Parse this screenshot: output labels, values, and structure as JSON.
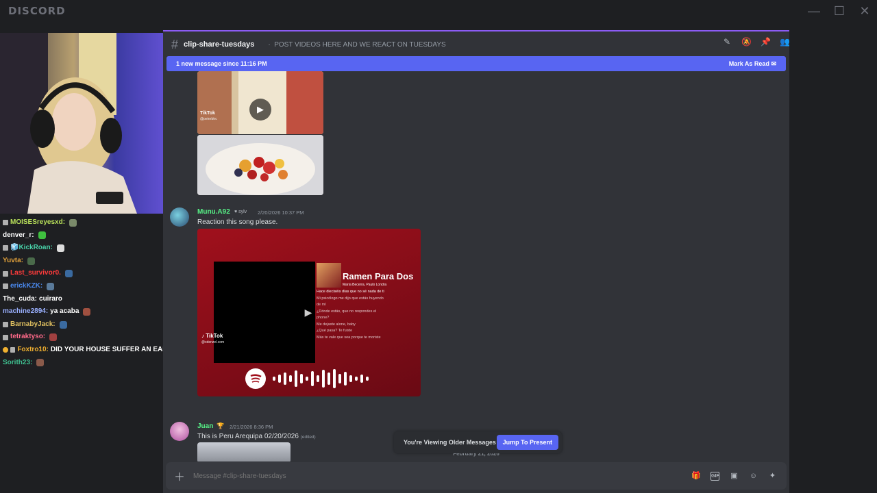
{
  "app": {
    "logo": "DISCORD"
  },
  "window_controls": {
    "minimize": "—",
    "maximize": "☐",
    "close": "✕"
  },
  "stream_chat": [
    {
      "badge": true,
      "user": "MOISESreyesxd:",
      "color": "#b8e05a",
      "text": "",
      "emote": "#7a8a6a"
    },
    {
      "badge": false,
      "user": "denver_r:",
      "color": "#ffffff",
      "text": "",
      "emote": "#3fbf3f"
    },
    {
      "badge": true,
      "user": "🧊KickRoan:",
      "color": "#48d1a8",
      "text": "",
      "emote": "#dddddd"
    },
    {
      "badge": false,
      "user": "Yuvta:",
      "color": "#e3a23b",
      "text": "",
      "emote": "#4a6a4a"
    },
    {
      "badge": true,
      "user": "Last_survivor0.",
      "color": "#ff3b3b",
      "text": "",
      "emote": "#3a6aa0"
    },
    {
      "badge": true,
      "user": "erickKZK:",
      "color": "#4a8af0",
      "text": "",
      "emote": "#5a7a9a"
    },
    {
      "badge": false,
      "user": "The_cuda:",
      "color": "#ffffff",
      "text": "cuiraro",
      "emote": ""
    },
    {
      "badge": false,
      "user": "machine2894:",
      "color": "#9ab0ff",
      "text": "ya acaba",
      "emote": "#a05040"
    },
    {
      "badge": true,
      "user": "BarnabyJack:",
      "color": "#e0c060",
      "text": "",
      "emote": "#3a6aa0"
    },
    {
      "badge": true,
      "user": "tetraktyso:",
      "color": "#ff6a8a",
      "text": "",
      "emote": "#a04040"
    },
    {
      "badge": true,
      "user": "Foxtro10:",
      "color": "#f0b030",
      "text": "DID YOUR HOUSE SUFFER AN EARTHQUAKE?",
      "emote": ""
    },
    {
      "badge": false,
      "user": "Sorith23:",
      "color": "#3fbf8f",
      "text": "",
      "emote": "#8a5a4a"
    }
  ],
  "channel": {
    "name": "clip-share-tuesdays",
    "topic": "POST VIDEOS HERE AND WE REACT ON TUESDAYS",
    "header_icons": [
      "threads-icon",
      "mute-icon",
      "pin-icon",
      "members-icon"
    ]
  },
  "new_message_bar": {
    "text": "1 new message since 11:16 PM",
    "action": "Mark As Read"
  },
  "messages": [
    {
      "author": "Munu.A92",
      "author_color": "#57f287",
      "tag": "sylv",
      "timestamp": "2/20/2026 10:37 PM",
      "text": "Reaction this song please."
    },
    {
      "author": "Juan",
      "author_color": "#57f287",
      "tag": "🏆",
      "timestamp": "2/21/2026 8:36 PM",
      "text": "This is Peru  Arequipa 02/20/2026",
      "edited": "(edited)"
    }
  ],
  "embed": {
    "tiktok_label": "TikTok",
    "tiktok_handle": "@peterbtrc",
    "tiktok2_handle": "@xdenzel.com",
    "song_title": "Ramen Para Dos",
    "song_artists": "María Becerra, Paulo Londra",
    "lyrics": [
      "Hace dieciséis días que no sé nada de ti",
      "Mi psicólogo me dijo que estás huyendo de mí",
      "¿Dónde estás, que no respondes el phone?",
      "Me dejaste alone, baby",
      "¿Qué pasa? Te fuiste",
      "Más te vale que sea porque te moriste",
      "Ay, ¿cómo puede ser? No me..."
    ]
  },
  "date_divider": "February 21, 2026",
  "jump_bar": {
    "text": "You're Viewing Older Messages",
    "button": "Jump To Present"
  },
  "composer": {
    "placeholder": "Message #clip-share-tuesdays",
    "icons": [
      "gift-icon",
      "gif-icon",
      "sticker-icon",
      "emoji-icon",
      "apps-icon"
    ]
  }
}
